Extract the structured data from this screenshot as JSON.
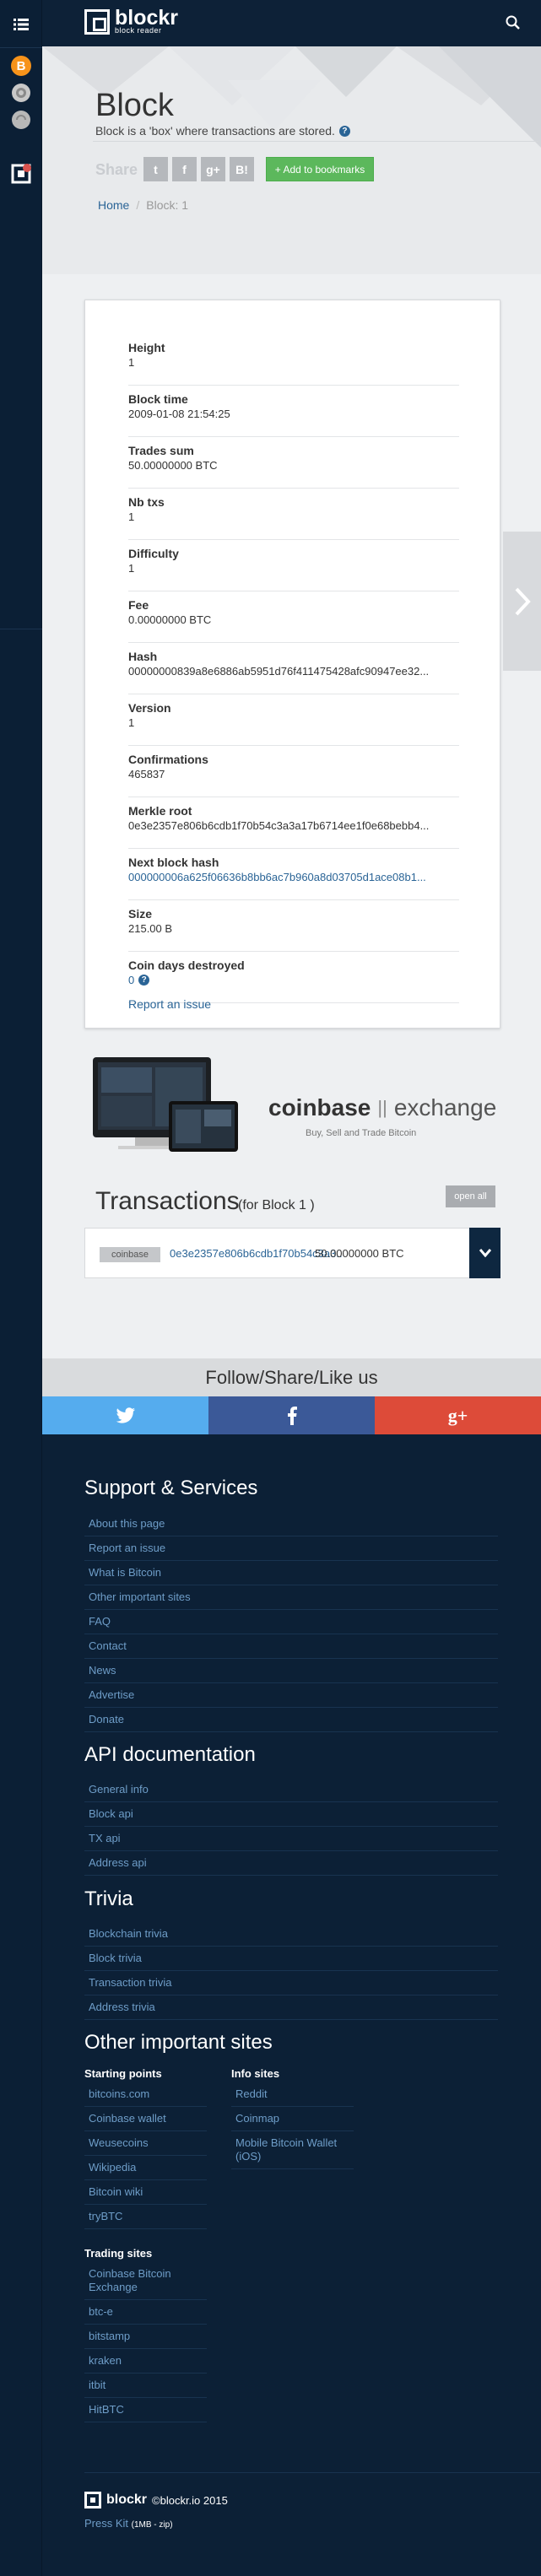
{
  "sidebar": {
    "items": [
      {
        "name": "list-icon"
      },
      {
        "name": "bitcoin-icon"
      },
      {
        "name": "gear-coin-icon"
      },
      {
        "name": "coin-icon"
      },
      {
        "name": "logo-badge-icon"
      }
    ]
  },
  "header": {
    "logo_name": "blockr",
    "logo_sub": "block reader"
  },
  "page": {
    "title": "Block",
    "subtitle": "Block is a 'box' where transactions are stored.",
    "share_label": "Share",
    "share_buttons": [
      "t",
      "f",
      "g+",
      "B!"
    ],
    "bookmark_label": "+ Add to bookmarks"
  },
  "breadcrumb": {
    "home": "Home",
    "sep": "/",
    "current": "Block: 1"
  },
  "block": {
    "fields": [
      {
        "label": "Height",
        "value": "1",
        "link": false
      },
      {
        "label": "Block time",
        "value": "2009-01-08 21:54:25",
        "link": false
      },
      {
        "label": "Trades sum",
        "value": "50.00000000 BTC",
        "link": false
      },
      {
        "label": "Nb txs",
        "value": "1",
        "link": false
      },
      {
        "label": "Difficulty",
        "value": "1",
        "link": false
      },
      {
        "label": "Fee",
        "value": "0.00000000 BTC",
        "link": false
      },
      {
        "label": "Hash",
        "value": "00000000839a8e6886ab5951d76f411475428afc90947ee32...",
        "link": false
      },
      {
        "label": "Version",
        "value": "1",
        "link": false
      },
      {
        "label": "Confirmations",
        "value": "465837",
        "link": false
      },
      {
        "label": "Merkle root",
        "value": "0e3e2357e806b6cdb1f70b54c3a3a17b6714ee1f0e68bebb4...",
        "link": false
      },
      {
        "label": "Next block hash",
        "value": "000000006a625f06636b8bb6ac7b960a8d03705d1ace08b1...",
        "link": true
      },
      {
        "label": "Size",
        "value": "215.00 B",
        "link": false
      },
      {
        "label": "Coin days destroyed",
        "value": "0",
        "link": false
      }
    ],
    "report_label": "Report an issue"
  },
  "ad": {
    "brand_bold": "coinbase",
    "brand_light": "exchange",
    "tagline": "Buy, Sell and Trade Bitcoin"
  },
  "transactions": {
    "title": "Transactions",
    "subtitle": "(for Block 1 )",
    "open_all": "open all",
    "rows": [
      {
        "badge": "coinbase",
        "hash": "0e3e2357e806b6cdb1f70b54c3a3..",
        "amount": "50.00000000 BTC"
      }
    ]
  },
  "follow": {
    "title": "Follow/Share/Like us",
    "colors": {
      "twitter": "#55acee",
      "facebook": "#3b5998",
      "google": "#dd4b39"
    }
  },
  "footer": {
    "support_title": "Support & Services",
    "support_links": [
      "About this page",
      "Report an issue",
      "What is Bitcoin",
      "Other important sites",
      "FAQ",
      "Contact",
      "News",
      "Advertise",
      "Donate"
    ],
    "api_title": "API documentation",
    "api_links": [
      "General info",
      "Block api",
      "TX api",
      "Address api"
    ],
    "trivia_title": "Trivia",
    "trivia_links": [
      "Blockchain trivia",
      "Block trivia",
      "Transaction trivia",
      "Address trivia"
    ],
    "other_title": "Other important sites",
    "starting_title": "Starting points",
    "starting_links": [
      "bitcoins.com",
      "Coinbase wallet",
      "Weusecoins",
      "Wikipedia",
      "Bitcoin wiki",
      "tryBTC"
    ],
    "info_title": "Info sites",
    "info_links": [
      "Reddit",
      "Coinmap",
      "Mobile Bitcoin Wallet (iOS)"
    ],
    "trading_title": "Trading sites",
    "trading_links": [
      "Coinbase Bitcoin Exchange",
      "btc-e",
      "bitstamp",
      "kraken",
      "itbit",
      "HitBTC"
    ],
    "copyright": "©blockr.io 2015",
    "brand": "blockr",
    "press_kit": "Press Kit",
    "press_kit_size": "(1MB - zip)"
  }
}
